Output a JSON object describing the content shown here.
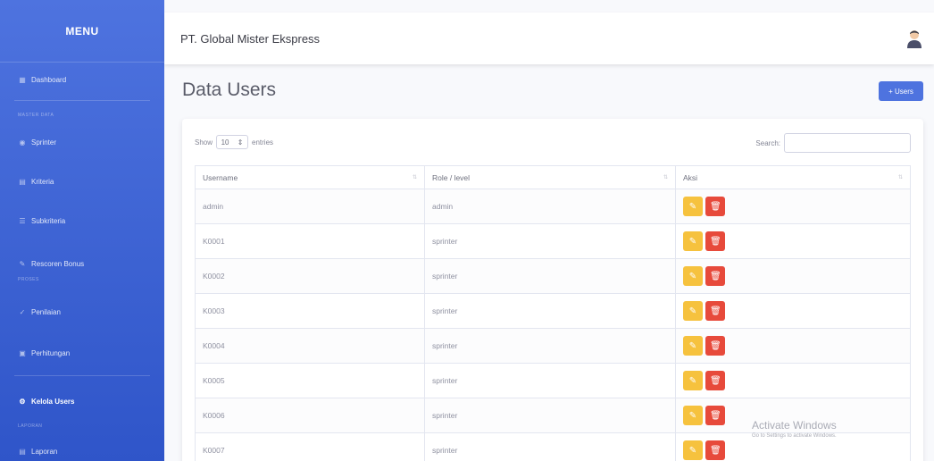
{
  "sidebar": {
    "brand": "MENU",
    "headings": [
      "MASTER DATA",
      "PROSES",
      "LAPORAN"
    ],
    "items": [
      {
        "label": "Dashboard",
        "icon": "dashboard-icon"
      },
      {
        "label": "Sprinter",
        "icon": "users-icon"
      },
      {
        "label": "Kriteria",
        "icon": "table-icon"
      },
      {
        "label": "Subkriteria",
        "icon": "list-icon"
      },
      {
        "label": "Rescoren Bonus",
        "icon": "edit-icon"
      },
      {
        "label": "Penilaian",
        "icon": "check-icon"
      },
      {
        "label": "Perhitungan",
        "icon": "calculator-icon"
      },
      {
        "label": "Kelola Users",
        "icon": "users-cog-icon"
      },
      {
        "label": "Laporan",
        "icon": "report-icon"
      }
    ]
  },
  "topbar": {
    "company": "PT. Global Mister Ekspress"
  },
  "page": {
    "title": "Data Users",
    "add_button": "+ Users"
  },
  "table_controls": {
    "show_label": "Show",
    "entries_value": "10",
    "entries_label": "entries",
    "search_label": "Search:"
  },
  "table": {
    "columns": [
      "Username",
      "Role / level",
      "Aksi"
    ],
    "rows": [
      {
        "username": "admin",
        "role": "admin"
      },
      {
        "username": "K0001",
        "role": "sprinter"
      },
      {
        "username": "K0002",
        "role": "sprinter"
      },
      {
        "username": "K0003",
        "role": "sprinter"
      },
      {
        "username": "K0004",
        "role": "sprinter"
      },
      {
        "username": "K0005",
        "role": "sprinter"
      },
      {
        "username": "K0006",
        "role": "sprinter"
      },
      {
        "username": "K0007",
        "role": "sprinter"
      }
    ]
  },
  "watermark": {
    "line1": "Activate Windows",
    "line2": "Go to Settings to activate Windows."
  },
  "colors": {
    "primary": "#4e73df",
    "warning": "#f6c23e",
    "danger": "#e74a3b"
  }
}
